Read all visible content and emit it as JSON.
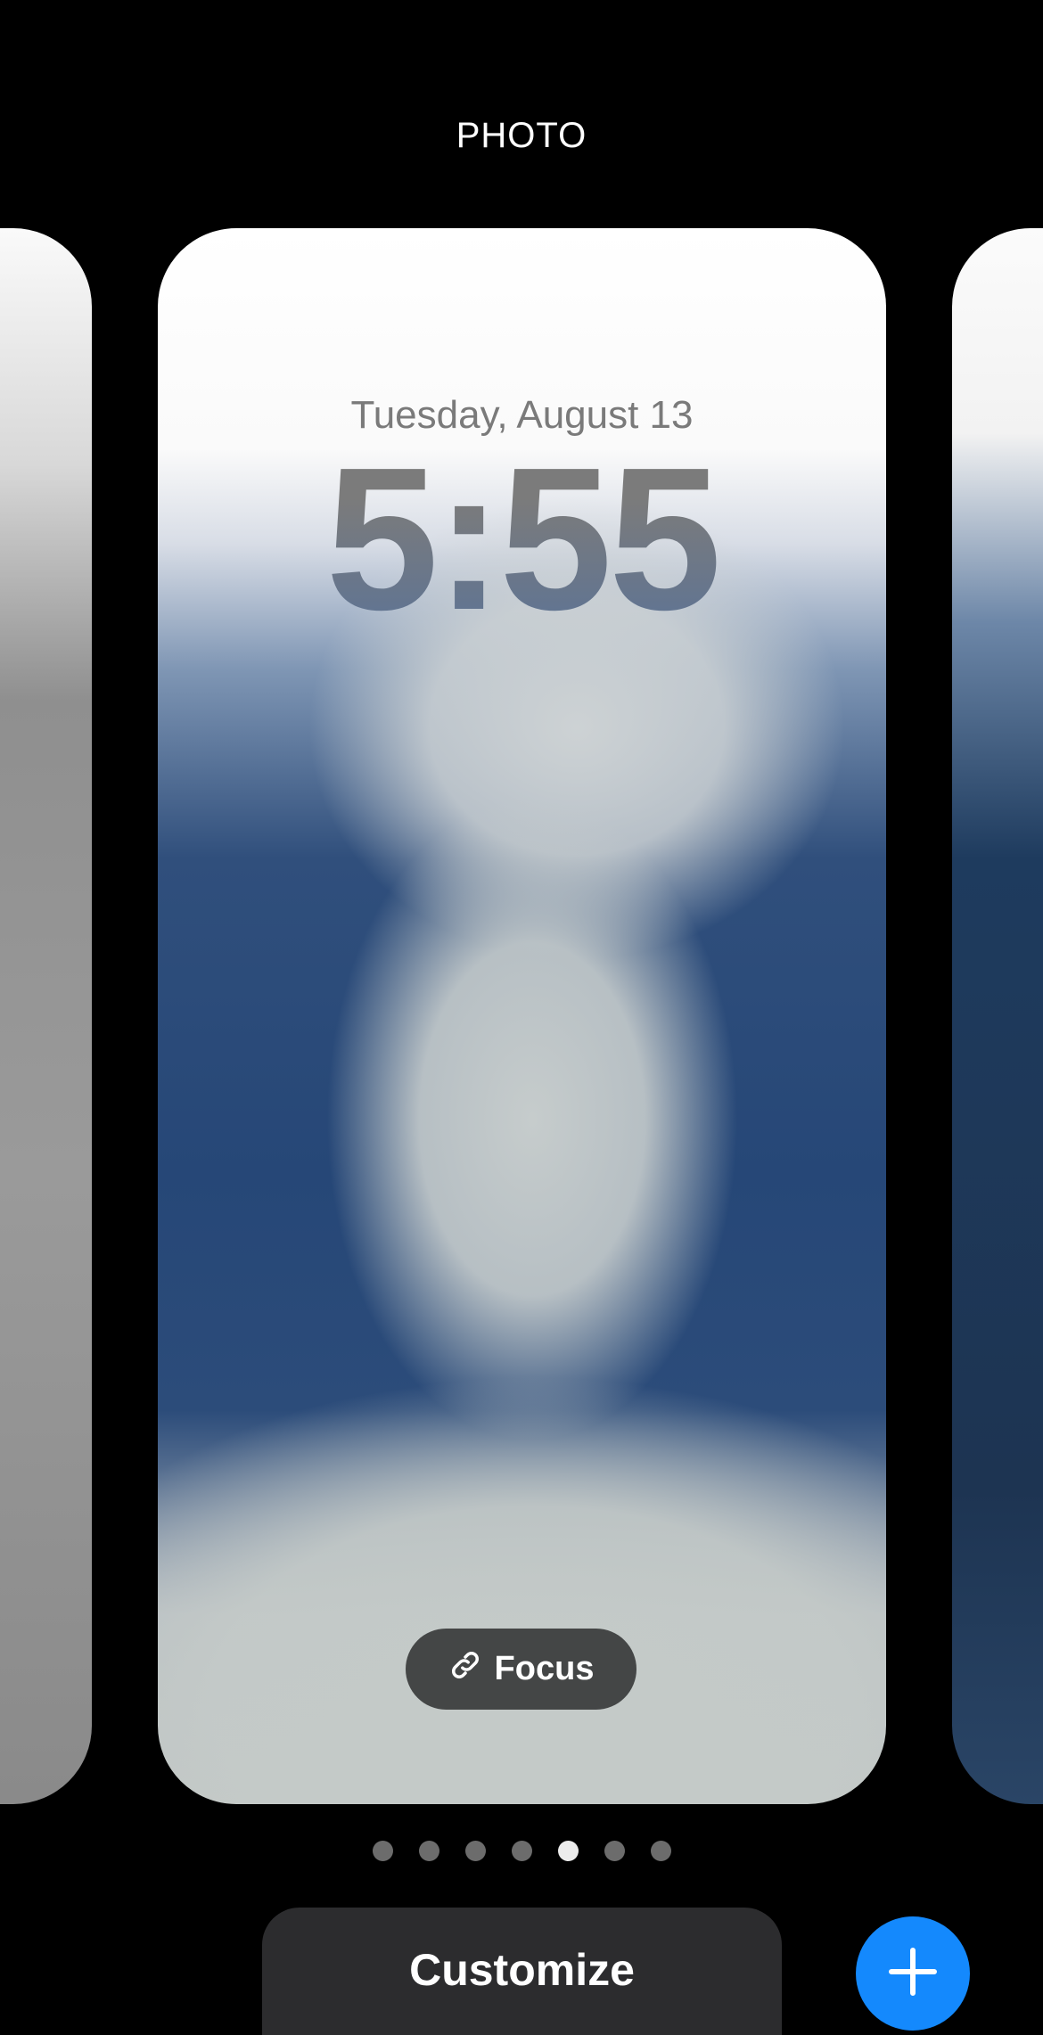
{
  "header": {
    "title": "PHOTO"
  },
  "lock_screen": {
    "date": "Tuesday, August 13",
    "time": "5:55",
    "focus_label": "Focus",
    "focus_icon": "link-icon"
  },
  "pagination": {
    "count": 7,
    "active_index": 4
  },
  "actions": {
    "customize_label": "Customize",
    "add_icon": "plus-icon"
  },
  "colors": {
    "accent": "#1489fd",
    "button_bg": "#2c2c2e",
    "background": "#000000"
  }
}
